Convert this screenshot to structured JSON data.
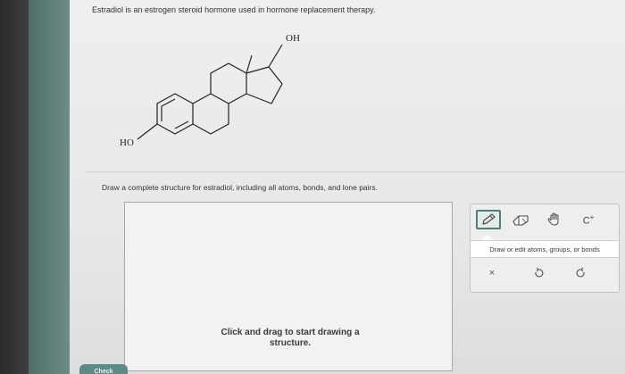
{
  "question": {
    "intro": "Estradiol is an estrogen steroid hormone used in hormone replacement therapy.",
    "instruction": "Draw a complete structure for estradiol, including all atoms, bonds, and lone pairs."
  },
  "molecule": {
    "oh_label": "OH",
    "ho_label": "HO"
  },
  "canvas": {
    "hint": "Click and drag to start drawing a structure."
  },
  "toolbar": {
    "tools": [
      {
        "name": "draw-tool",
        "icon": "pencil-icon",
        "active": true
      },
      {
        "name": "erase-tool",
        "icon": "eraser-icon",
        "active": false
      },
      {
        "name": "move-tool",
        "icon": "hand-icon",
        "active": false
      },
      {
        "name": "charge-tool",
        "icon": "carbocation-icon",
        "label": "C",
        "superscript": "+",
        "active": false
      }
    ],
    "tip": "Draw or edit atoms, groups, or bonds",
    "actions": [
      {
        "name": "clear-button",
        "icon": "x-icon",
        "glyph": "×"
      },
      {
        "name": "undo-button",
        "icon": "undo-icon"
      },
      {
        "name": "redo-button",
        "icon": "redo-icon"
      }
    ]
  },
  "buttons": {
    "check": "Check"
  },
  "colors": {
    "accent": "#4f7f7a",
    "check_button": "#5c8a85"
  }
}
